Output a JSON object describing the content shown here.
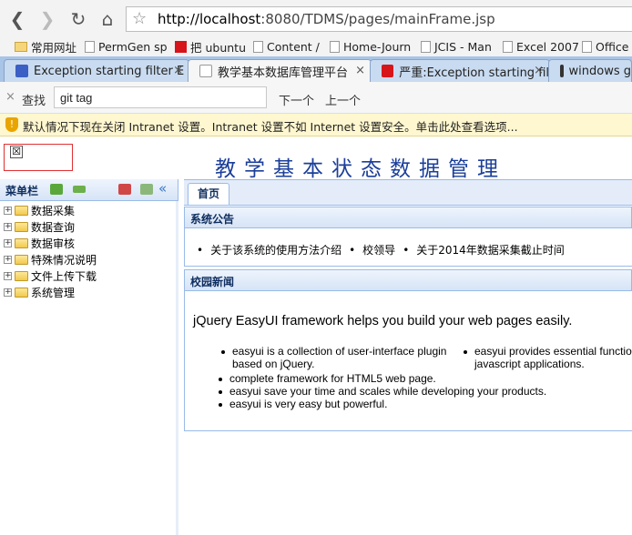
{
  "browser": {
    "url_host": "http://localhost",
    "url_rest": ":8080/TDMS/pages/mainFrame.jsp",
    "bookmarks": [
      "常用网址",
      "PermGen sp",
      "把 ubuntu",
      "Content /",
      "Home-Journ",
      "JCIS - Man",
      "Excel 2007",
      "Office"
    ],
    "tabs": [
      {
        "label": "Exception starting filter E",
        "active": false
      },
      {
        "label": "教学基本数据库管理平台",
        "active": true
      },
      {
        "label": "严重:Exception starting fil",
        "active": false
      },
      {
        "label": "windows g",
        "active": false
      }
    ],
    "tab_close": "×"
  },
  "findbar": {
    "close": "×",
    "label": "查找",
    "query": "git tag",
    "next": "下一个",
    "prev": "上一个"
  },
  "infobar": {
    "text": "默认情况下现在关闭 Intranet 设置。Intranet 设置不如 Internet 设置安全。单击此处查看选项..."
  },
  "page": {
    "title": "教学基本状态数据管理",
    "logo_broken": "☒"
  },
  "sidebar": {
    "title": "菜单栏",
    "collapse": "«",
    "items": [
      {
        "label": "数据采集"
      },
      {
        "label": "数据查询"
      },
      {
        "label": "数据审核"
      },
      {
        "label": "特殊情况说明"
      },
      {
        "label": "文件上传下载"
      },
      {
        "label": "系统管理"
      }
    ]
  },
  "main": {
    "tab": "首页",
    "notice": {
      "title": "系统公告",
      "items": [
        "关于该系统的使用方法介绍",
        "校领导",
        "关于2014年数据采集截止时间"
      ]
    },
    "news": {
      "title": "校园新闻",
      "heading": "jQuery EasyUI framework helps you build your web pages easily.",
      "col1_line1": "easyui is a collection of user-interface plugin",
      "col1_line2": "based on jQuery.",
      "col2_line1": "easyui provides essential functio",
      "col2_line2": "javascript applications.",
      "items": [
        "complete framework for HTML5 web page.",
        "easyui save your time and scales while developing your products.",
        "easyui is very easy but powerful."
      ]
    }
  }
}
